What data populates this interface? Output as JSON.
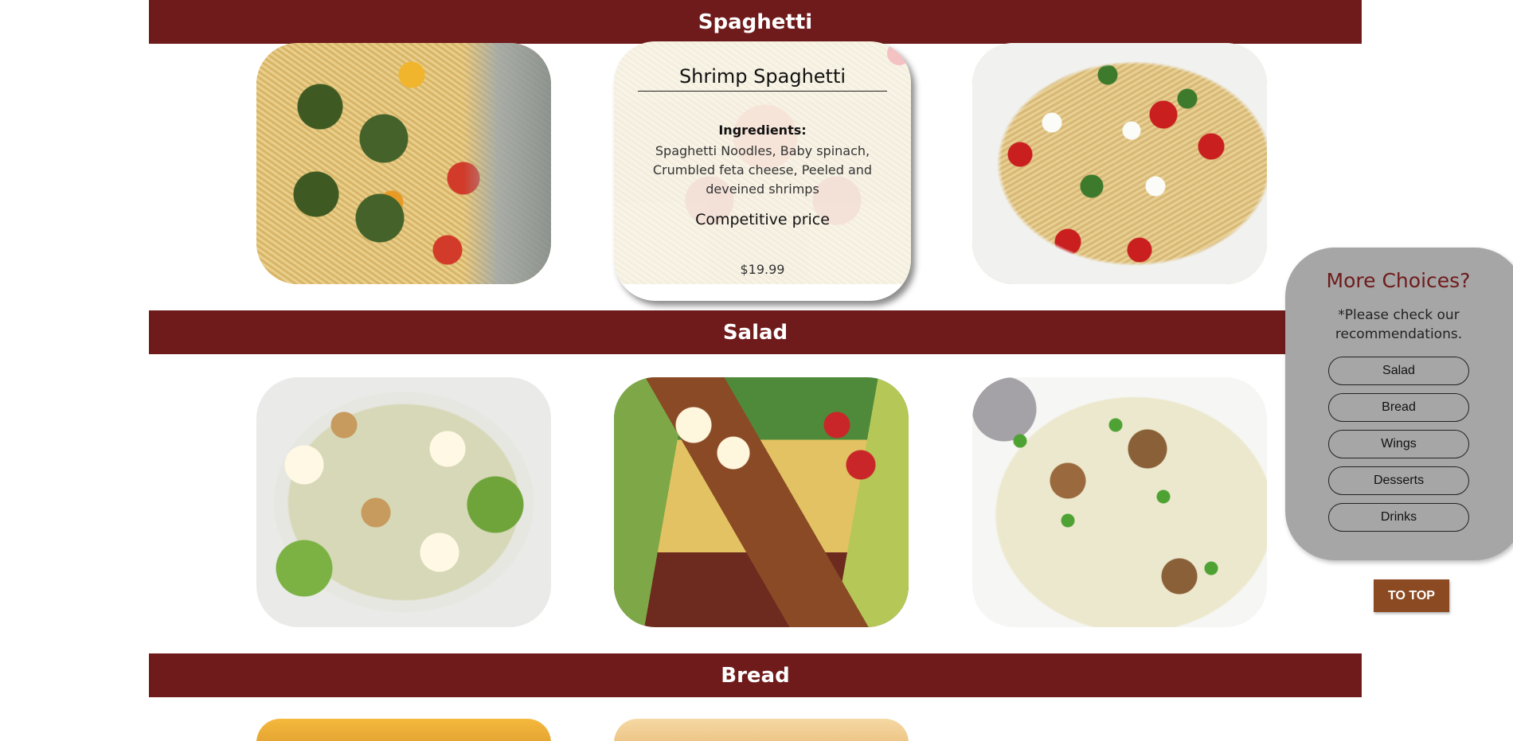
{
  "sections": [
    {
      "title": "Spaghetti"
    },
    {
      "title": "Salad"
    },
    {
      "title": "Bread"
    }
  ],
  "overlay": {
    "title": "Shrimp Spaghetti",
    "ingredients_heading": "Ingredients:",
    "ingredients": "Spaghetti Noodles, Baby spinach, Crumbled feta cheese, Peeled and deveined shrimps",
    "subtitle": "Competitive price",
    "price": "$19.99"
  },
  "sidebar": {
    "title": "More Choices?",
    "note": "*Please check our recommendations.",
    "buttons": [
      "Salad",
      "Bread",
      "Wings",
      "Desserts",
      "Drinks"
    ]
  },
  "to_top": "TO TOP",
  "colors": {
    "band": "#6f1b1b",
    "sidebar_bg": "#a6a6a6",
    "sidebar_title": "#6f1b1b",
    "to_top_bg": "#8b4a22"
  }
}
